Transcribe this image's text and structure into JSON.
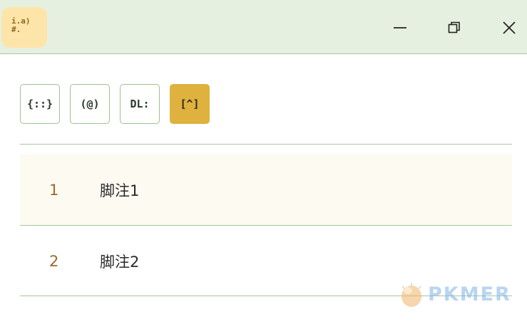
{
  "app_icon": {
    "line1": "i.a)",
    "line2": "#."
  },
  "window_controls": {
    "minimize": "minimize-icon",
    "maximize": "restore-icon",
    "close": "close-icon"
  },
  "toolbar": {
    "buttons": [
      {
        "label": "{::}",
        "active": false
      },
      {
        "label": "(@)",
        "active": false
      },
      {
        "label": "DL:",
        "active": false
      },
      {
        "label": "[^]",
        "active": true
      }
    ]
  },
  "footnotes": [
    {
      "number": "1",
      "text": "脚注1"
    },
    {
      "number": "2",
      "text": "脚注2"
    }
  ],
  "watermark": {
    "text": "PKMER"
  },
  "colors": {
    "titlebar": "#e6f0e0",
    "accent": "#dfb13e",
    "border": "#a9c69d",
    "highlight_row": "#fcfaf1",
    "number": "#9a6b26"
  }
}
